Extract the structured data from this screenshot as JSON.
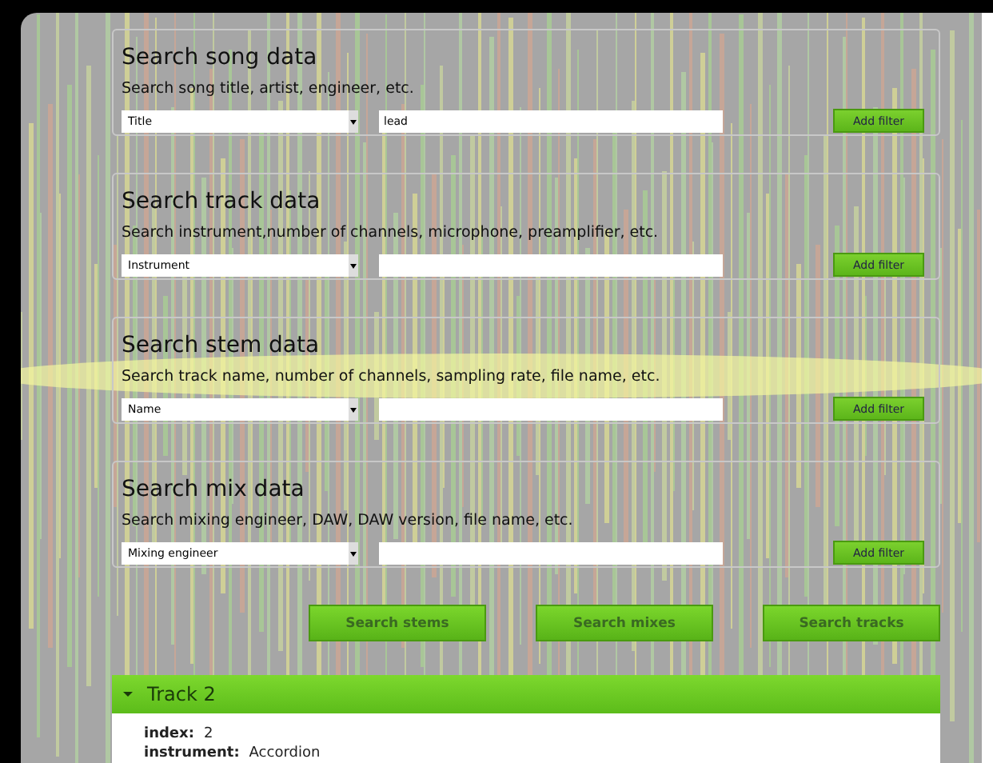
{
  "sections": [
    {
      "title": "Search song data",
      "description": "Search song title, artist, engineer, etc.",
      "field": "Title",
      "value": "lead",
      "button": "Add filter"
    },
    {
      "title": "Search track data",
      "description": "Search instrument,number of channels, microphone, preamplifier, etc.",
      "field": "Instrument",
      "button": "Add filter"
    },
    {
      "title": "Search stem data",
      "description": "Search track name, number of channels, sampling rate, file name, etc.",
      "field": "Name",
      "button": "Add filter"
    },
    {
      "title": "Search mix data",
      "description": "Search mixing engineer, DAW, DAW version, file name, etc.",
      "field": "Mixing engineer",
      "button": "Add filter"
    }
  ],
  "actions": [
    "Search stems",
    "Search mixes",
    "Search tracks"
  ],
  "result": {
    "title": "Track 2",
    "expanded": true,
    "fields": [
      {
        "label": "index:",
        "value": "2"
      },
      {
        "label": "instrument:",
        "value": "Accordion"
      }
    ]
  }
}
